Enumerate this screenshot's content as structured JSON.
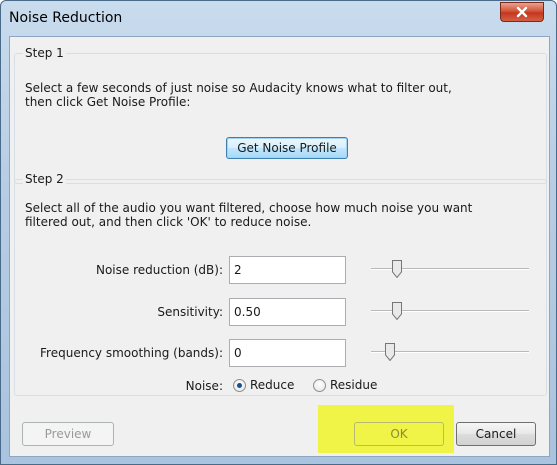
{
  "window": {
    "title": "Noise Reduction"
  },
  "step1": {
    "label": "Step 1",
    "description": "Select a few seconds of just noise so Audacity knows what to filter out,\nthen click Get Noise Profile:",
    "button": "Get Noise Profile"
  },
  "step2": {
    "label": "Step 2",
    "description": "Select all of the audio you want filtered, choose how much noise you want\nfiltered out, and then click 'OK' to reduce noise."
  },
  "fields": {
    "noise_reduction": {
      "label": "Noise reduction (dB):",
      "value": "2",
      "slider_fraction": 0.05
    },
    "sensitivity": {
      "label": "Sensitivity:",
      "value": "0.50",
      "slider_fraction": 0.05
    },
    "frequency_smoothing": {
      "label": "Frequency smoothing (bands):",
      "value": "0",
      "slider_fraction": 0.0
    }
  },
  "noise": {
    "label": "Noise:",
    "options": [
      "Reduce",
      "Residue"
    ],
    "selected": "Reduce"
  },
  "buttons": {
    "preview": "Preview",
    "ok": "OK",
    "cancel": "Cancel"
  },
  "colors": {
    "highlight": "#eef42e",
    "close_button": "#c2371e",
    "focus_border": "#3c7fb1"
  },
  "icons": {
    "close": "close-icon"
  }
}
